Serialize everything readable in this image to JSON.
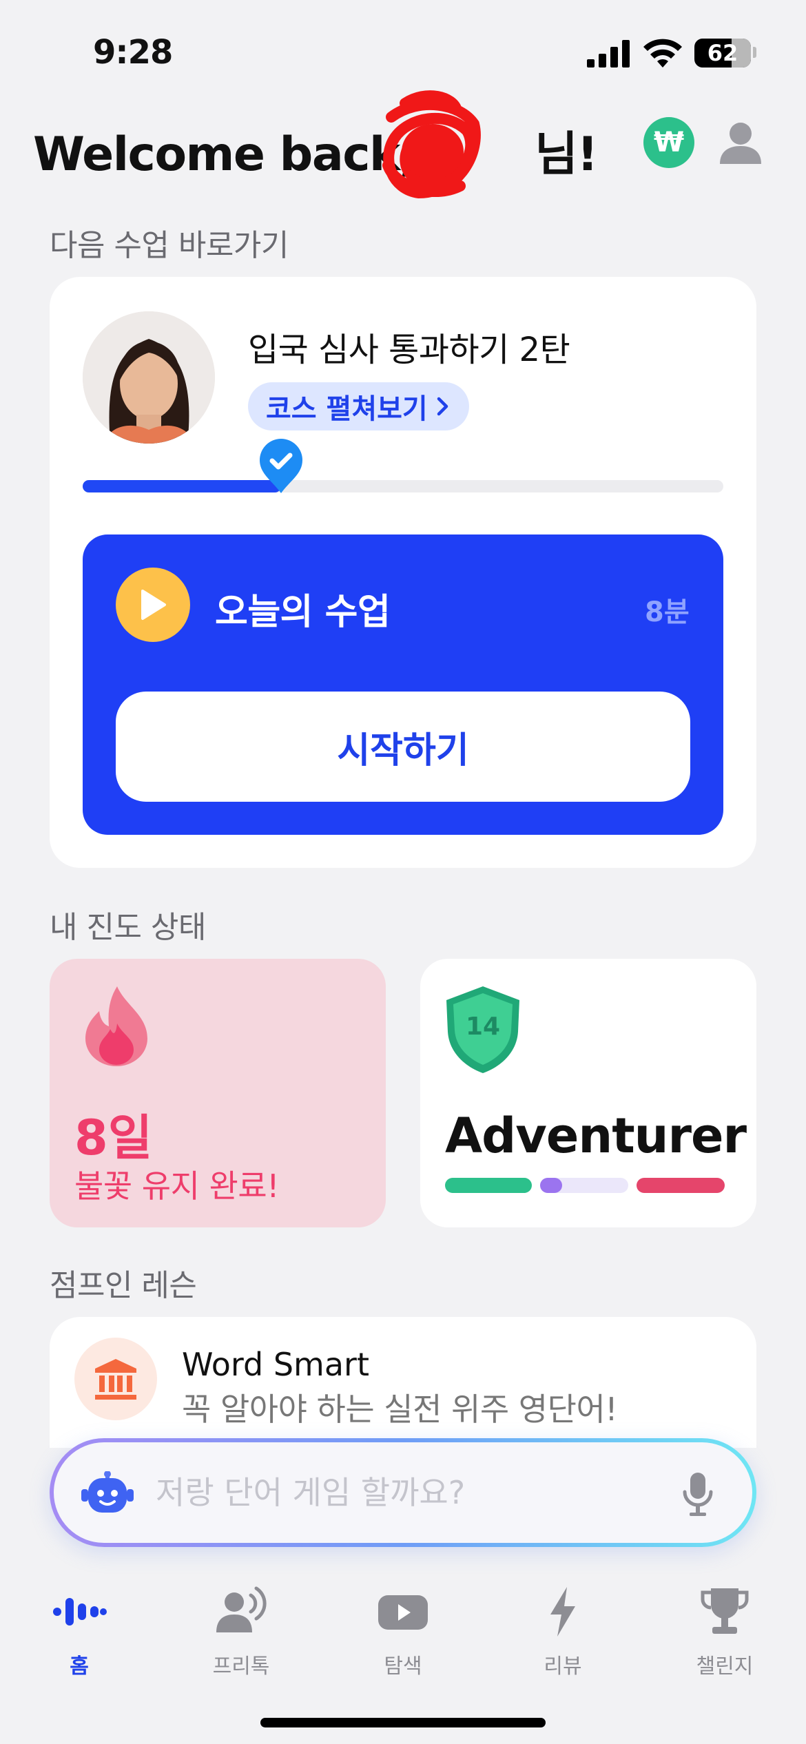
{
  "status_bar": {
    "time": "9:28",
    "battery": "62"
  },
  "header": {
    "welcome": "Welcome back, ",
    "welcome_suffix": "님!",
    "coin_symbol": "₩"
  },
  "next_lesson": {
    "section_title": "다음 수업 바로가기",
    "lesson_title": "입국 심사 통과하기 2탄",
    "course_chip": "코스 펼쳐보기",
    "progress": 0.31,
    "today_label": "오늘의 수업",
    "duration": "8분",
    "start_button": "시작하기"
  },
  "progress_status": {
    "section_title": "내 진도 상태",
    "streak_days": "8일",
    "streak_text": "불꽃 유지 완료!",
    "level_number": "14",
    "level_name": "Adventurer",
    "level_bars": [
      {
        "color": "#2cc08b",
        "fill": 1.0
      },
      {
        "color": "#9b74ef",
        "fill": 0.25
      },
      {
        "color": "#e5456b",
        "fill": 1.0
      }
    ]
  },
  "jump_in": {
    "section_title": "점프인 레슨",
    "title": "Word Smart",
    "subtitle": "꼭 알아야 하는 실전 위주 영단어!"
  },
  "chat": {
    "placeholder": "저랑 단어 게임 할까요?"
  },
  "tabs": [
    {
      "label": "홈",
      "icon": "home-waveform-icon",
      "active": true
    },
    {
      "label": "프리톡",
      "icon": "free-talk-icon",
      "active": false
    },
    {
      "label": "탐색",
      "icon": "play-explore-icon",
      "active": false
    },
    {
      "label": "리뷰",
      "icon": "lightning-icon",
      "active": false
    },
    {
      "label": "챌린지",
      "icon": "trophy-icon",
      "active": false
    }
  ],
  "colors": {
    "accent": "#1f41ea",
    "streak": "#ee3d6b",
    "coin": "#2cc08b"
  }
}
